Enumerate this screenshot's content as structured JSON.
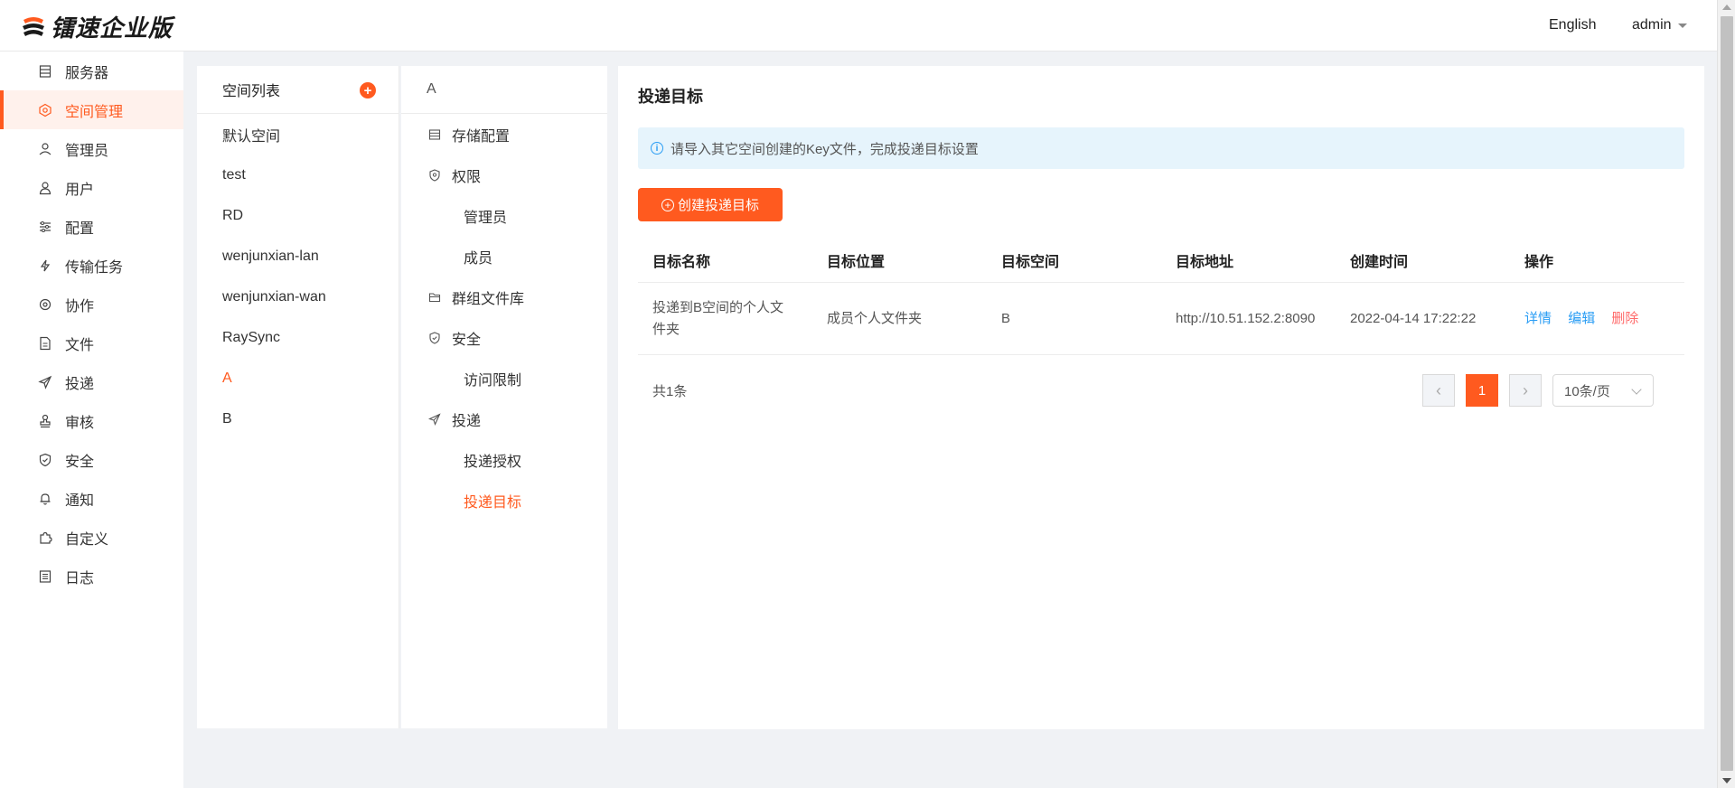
{
  "header": {
    "brand": "镭速企业版",
    "language": "English",
    "user": "admin"
  },
  "sidebar": {
    "items": [
      {
        "label": "服务器",
        "icon": "server-icon"
      },
      {
        "label": "空间管理",
        "icon": "space-icon",
        "active": true
      },
      {
        "label": "管理员",
        "icon": "admin-icon"
      },
      {
        "label": "用户",
        "icon": "user-icon"
      },
      {
        "label": "配置",
        "icon": "sliders-icon"
      },
      {
        "label": "传输任务",
        "icon": "transfer-icon"
      },
      {
        "label": "协作",
        "icon": "collab-icon"
      },
      {
        "label": "文件",
        "icon": "file-icon"
      },
      {
        "label": "投递",
        "icon": "send-icon"
      },
      {
        "label": "审核",
        "icon": "stamp-icon"
      },
      {
        "label": "安全",
        "icon": "shield-icon"
      },
      {
        "label": "通知",
        "icon": "bell-icon"
      },
      {
        "label": "自定义",
        "icon": "puzzle-icon"
      },
      {
        "label": "日志",
        "icon": "log-icon"
      }
    ]
  },
  "spaces": {
    "title": "空间列表",
    "items": [
      "默认空间",
      "test",
      "RD",
      "wenjunxian-lan",
      "wenjunxian-wan",
      "RaySync",
      "A",
      "B"
    ],
    "active_index": 6
  },
  "space_settings": {
    "title": "A",
    "storage": "存储配置",
    "permission": "权限",
    "perm_admin": "管理员",
    "perm_member": "成员",
    "group_lib": "群组文件库",
    "security": "安全",
    "access_limit": "访问限制",
    "delivery": "投递",
    "delivery_auth": "投递授权",
    "delivery_target": "投递目标"
  },
  "main": {
    "title": "投递目标",
    "alert": "请导入其它空间创建的Key文件，完成投递目标设置",
    "create_button": "创建投递目标",
    "columns": [
      "目标名称",
      "目标位置",
      "目标空间",
      "目标地址",
      "创建时间",
      "操作"
    ],
    "rows": [
      {
        "name": "投递到B空间的个人文件夹",
        "location": "成员个人文件夹",
        "space": "B",
        "address": "http://10.51.152.2:8090",
        "created": "2022-04-14 17:22:22",
        "actions": {
          "detail": "详情",
          "edit": "编辑",
          "delete": "删除"
        }
      }
    ],
    "total": "共1条",
    "pagination": {
      "current_page": "1",
      "page_size": "10条/页"
    }
  },
  "colors": {
    "accent": "#ff5a1f",
    "link": "#2a9df4",
    "danger": "#ff6a6a"
  }
}
